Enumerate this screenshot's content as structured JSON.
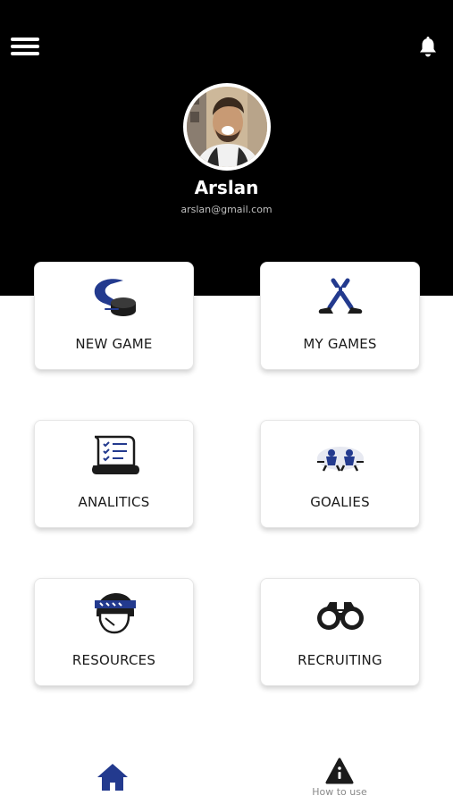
{
  "header": {
    "menu_icon": "hamburger-menu-icon",
    "notification_icon": "bell-icon"
  },
  "profile": {
    "name": "Arslan",
    "email": "arslan@gmail.com"
  },
  "menu": {
    "new_game": "NEW GAME",
    "my_games": "MY GAMES",
    "analytics": "ANALITICS",
    "goalies": "GOALIES",
    "resources": "RESOURCES",
    "recruiting": "RECRUITING"
  },
  "bottom_nav": {
    "home_icon": "home-icon",
    "how_to_use": "How to use"
  },
  "colors": {
    "header_bg": "#000000",
    "accent": "#233a8e",
    "text": "#1a1a1a"
  }
}
